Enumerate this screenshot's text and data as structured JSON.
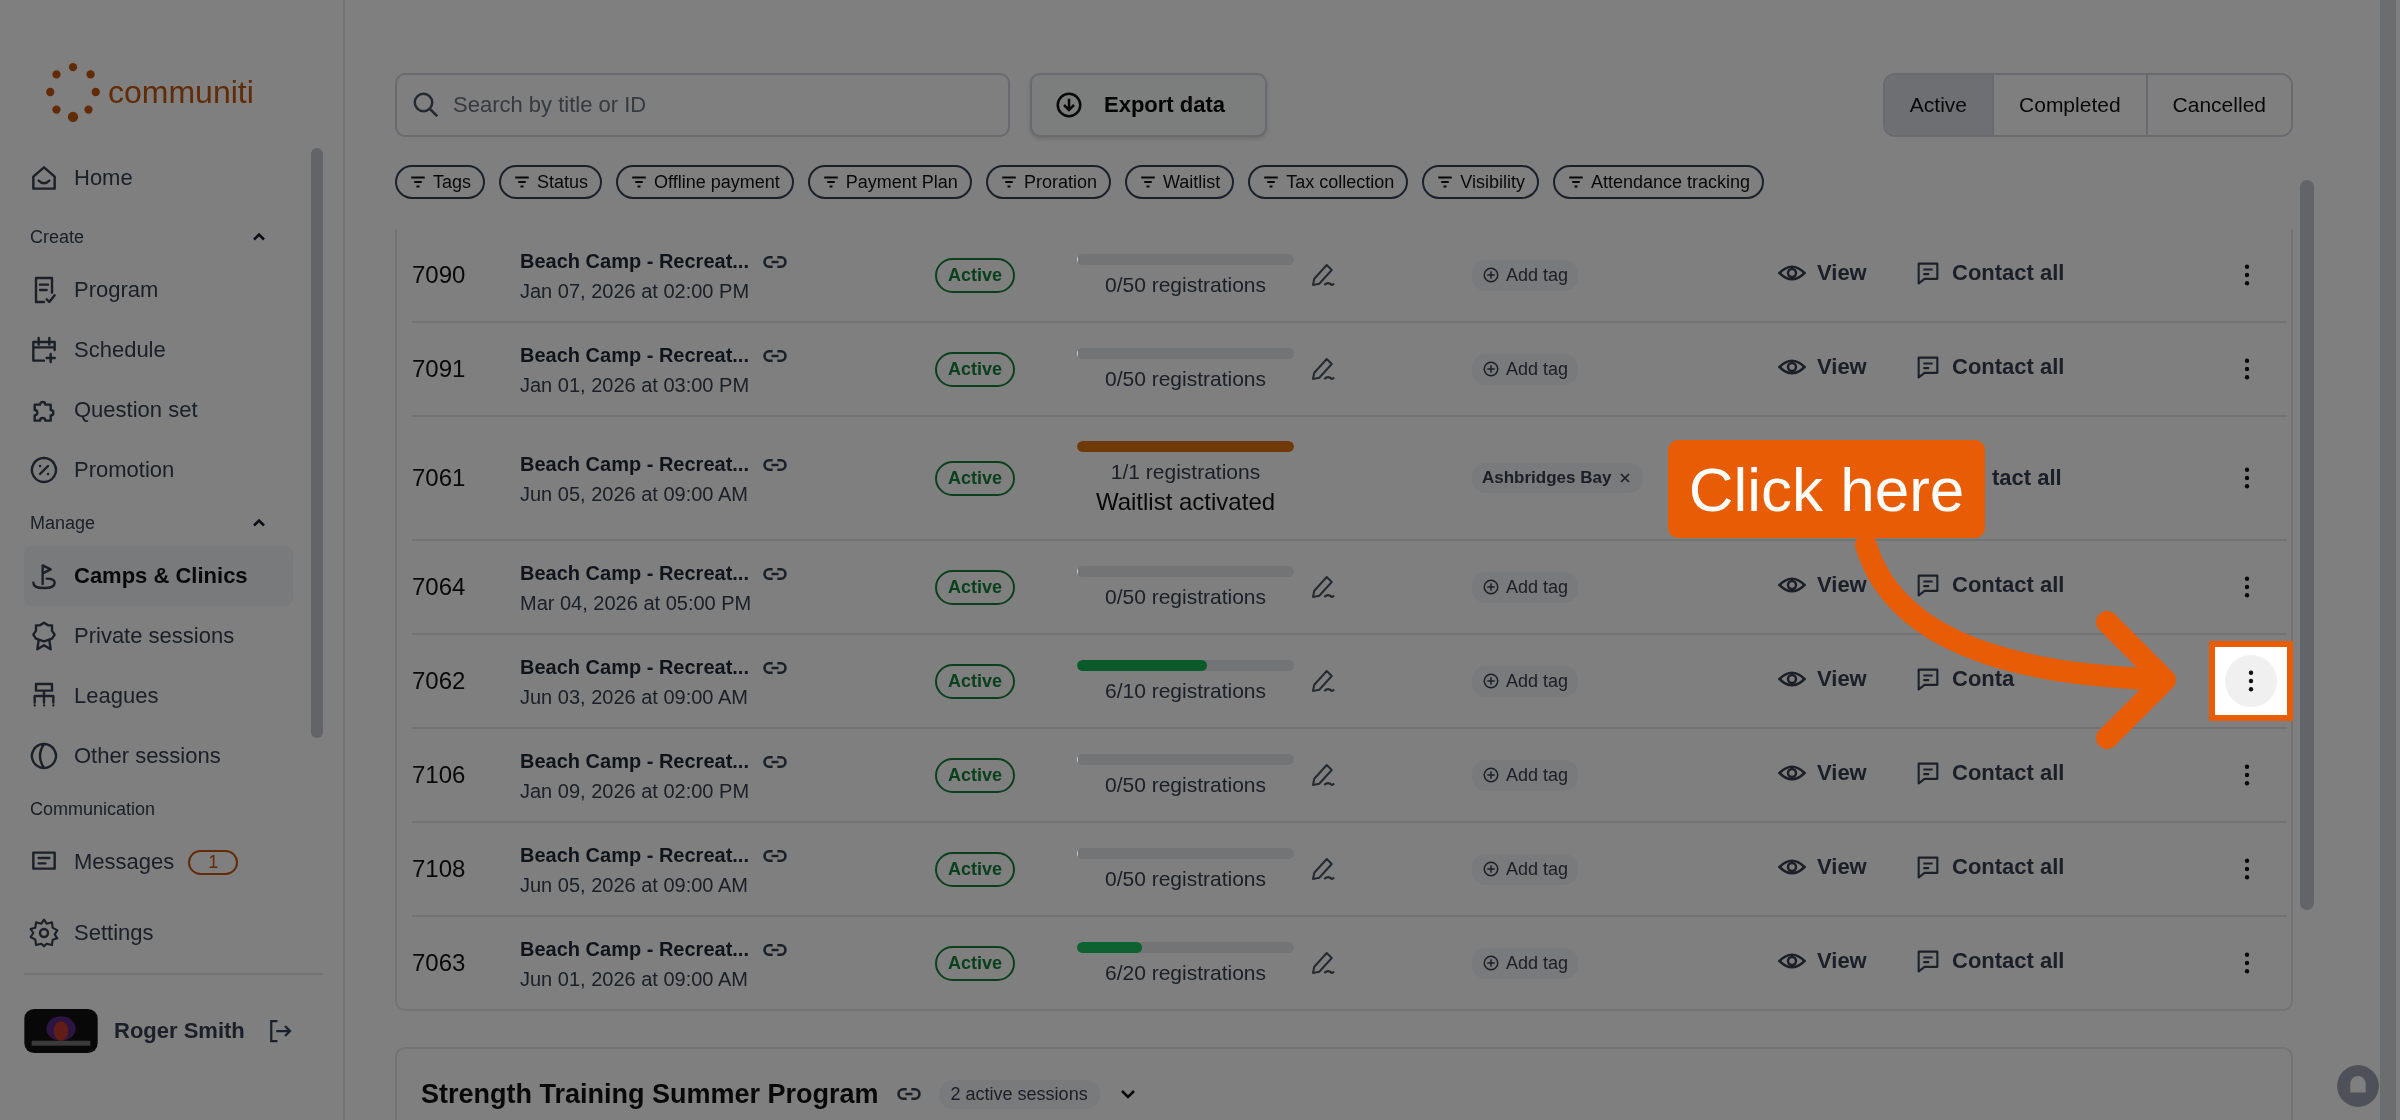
{
  "logo": {
    "text": "communiti"
  },
  "sidebar": {
    "nav": [
      {
        "kind": "item",
        "label": "Home",
        "selected": false
      },
      {
        "kind": "section",
        "label": "Create",
        "expanded": true
      },
      {
        "kind": "item",
        "label": "Program",
        "selected": false
      },
      {
        "kind": "item",
        "label": "Schedule",
        "selected": false
      },
      {
        "kind": "item",
        "label": "Question set",
        "selected": false
      },
      {
        "kind": "item",
        "label": "Promotion",
        "selected": false
      },
      {
        "kind": "section",
        "label": "Manage",
        "expanded": true
      },
      {
        "kind": "item",
        "label": "Camps & Clinics",
        "selected": true
      },
      {
        "kind": "item",
        "label": "Private sessions",
        "selected": false
      },
      {
        "kind": "item",
        "label": "Leagues",
        "selected": false
      },
      {
        "kind": "item",
        "label": "Other sessions",
        "selected": false
      },
      {
        "kind": "section",
        "label": "Communication"
      },
      {
        "kind": "item",
        "label": "Messages",
        "selected": false,
        "badge": "1"
      }
    ],
    "settings": "Settings",
    "user": {
      "name": "Roger Smith"
    }
  },
  "toolbar": {
    "search": {
      "placeholder": "Search by title or ID"
    },
    "export": "Export data",
    "tabs": [
      {
        "label": "Active",
        "selected": true
      },
      {
        "label": "Completed",
        "selected": false
      },
      {
        "label": "Cancelled",
        "selected": false
      }
    ],
    "filters": [
      "Tags",
      "Status",
      "Offline payment",
      "Payment Plan",
      "Proration",
      "Waitlist",
      "Tax collection",
      "Visibility",
      "Attendance tracking"
    ]
  },
  "rows": [
    {
      "id": "7090",
      "title": "Beach Camp - Recreat...",
      "date": "Jan 07, 2026 at 02:00 PM",
      "status": "Active",
      "level": 0,
      "registrations": "0/50 registrations",
      "editable": true,
      "tag": {
        "kind": "add",
        "label": "Add tag"
      },
      "view": "View",
      "contact": "Contact all",
      "highlighted": false
    },
    {
      "id": "7091",
      "title": "Beach Camp - Recreat...",
      "date": "Jan 01, 2026 at 03:00 PM",
      "status": "Active",
      "level": 0,
      "registrations": "0/50 registrations",
      "editable": true,
      "tag": {
        "kind": "add",
        "label": "Add tag"
      },
      "view": "View",
      "contact": "Contact all",
      "highlighted": false
    },
    {
      "id": "7061",
      "title": "Beach Camp - Recreat...",
      "date": "Jun 05, 2026 at 09:00 AM",
      "status": "Active",
      "level": 1,
      "color": "#703a06",
      "registrations": "1/1 registrations",
      "note": "Waitlist activated",
      "editable": false,
      "tag": {
        "kind": "chip",
        "label": "Ashbridges Bay"
      },
      "contact": "tact all",
      "covered": true,
      "highlighted": false
    },
    {
      "id": "7064",
      "title": "Beach Camp - Recreat...",
      "date": "Mar 04, 2026 at 05:00 PM",
      "status": "Active",
      "level": 0,
      "registrations": "0/50 registrations",
      "editable": true,
      "tag": {
        "kind": "add",
        "label": "Add tag"
      },
      "view": "View",
      "contact": "Contact all",
      "highlighted": false
    },
    {
      "id": "7062",
      "title": "Beach Camp - Recreat...",
      "date": "Jun 03, 2026 at 09:00 AM",
      "status": "Active",
      "level": 0.6,
      "color": "#0a5a2b",
      "registrations": "6/10 registrations",
      "editable": true,
      "tag": {
        "kind": "add",
        "label": "Add tag"
      },
      "view": "View",
      "contact": "Conta",
      "highlighted": true
    },
    {
      "id": "7106",
      "title": "Beach Camp - Recreat...",
      "date": "Jan 09, 2026 at 02:00 PM",
      "status": "Active",
      "level": 0,
      "registrations": "0/50 registrations",
      "editable": true,
      "tag": {
        "kind": "add",
        "label": "Add tag"
      },
      "view": "View",
      "contact": "Contact all",
      "highlighted": false
    },
    {
      "id": "7108",
      "title": "Beach Camp - Recreat...",
      "date": "Jun 05, 2026 at 09:00 AM",
      "status": "Active",
      "level": 0,
      "registrations": "0/50 registrations",
      "editable": true,
      "tag": {
        "kind": "add",
        "label": "Add tag"
      },
      "view": "View",
      "contact": "Contact all",
      "highlighted": false
    },
    {
      "id": "7063",
      "title": "Beach Camp - Recreat...",
      "date": "Jun 01, 2026 at 09:00 AM",
      "status": "Active",
      "level": 0.3,
      "color": "#0e6131",
      "registrations": "6/20 registrations",
      "editable": true,
      "tag": {
        "kind": "add",
        "label": "Add tag"
      },
      "view": "View",
      "contact": "Contact all",
      "highlighted": false
    }
  ],
  "group": {
    "title": "Strength Training Summer Program",
    "badge": "2 active sessions",
    "expanded": false
  },
  "callout": {
    "text": "Click here"
  }
}
